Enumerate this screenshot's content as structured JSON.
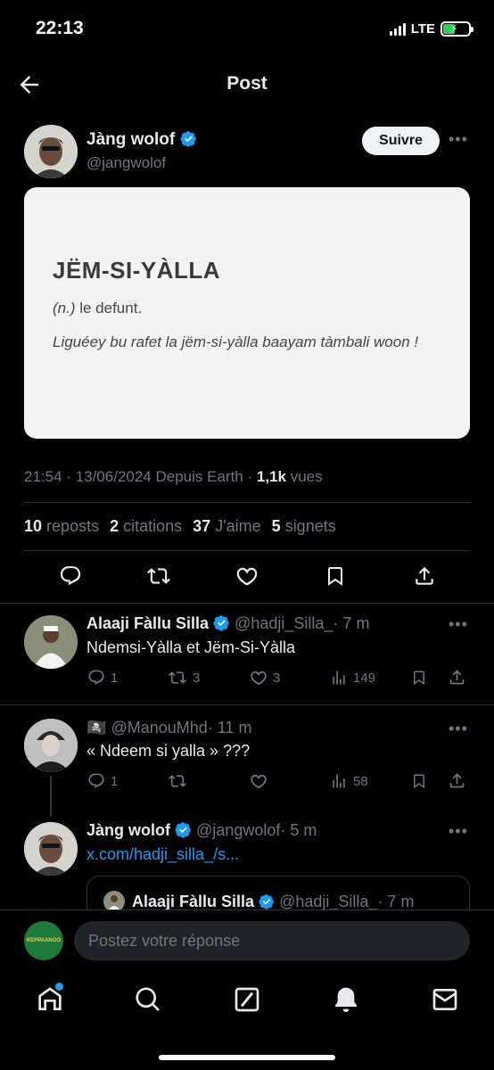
{
  "status_bar": {
    "time": "22:13",
    "network": "LTE"
  },
  "header": {
    "title": "Post"
  },
  "post": {
    "author_name": "Jàng wolof",
    "author_handle": "@jangwolof",
    "follow_label": "Suivre",
    "card": {
      "word": "JËM-SI-YÀLLA",
      "pos": "(n.)",
      "definition": " le defunt.",
      "example": "Liguéey bu rafet la jëm-si-yàlla baayam tàmbali woon !"
    },
    "time": "21:54",
    "date": "13/06/2024",
    "source": "Depuis Earth",
    "views_count": "1,1k",
    "views_label": "vues",
    "stats": {
      "reposts_count": "10",
      "reposts_label": "reposts",
      "quotes_count": "2",
      "quotes_label": "citations",
      "likes_count": "37",
      "likes_label": "J'aime",
      "bookmarks_count": "5",
      "bookmarks_label": "signets"
    }
  },
  "replies": [
    {
      "name": "Alaaji Fàllu Silla",
      "handle": "@hadji_Silla_",
      "age": "· 7 m",
      "text": "Ndemsi-Yàlla et Jëm-Si-Yàlla",
      "replies": "1",
      "reposts": "3",
      "likes": "3",
      "views": "149"
    },
    {
      "name": "🏴‍☠️",
      "handle": "@ManouMhd",
      "age": "· 11 m",
      "text": "« Ndeem si yalla » ???",
      "replies": "1",
      "reposts": "",
      "likes": "",
      "views": "58"
    },
    {
      "name": "Jàng wolof",
      "handle": "@jangwolof",
      "age": "· 5 m",
      "text": "x.com/hadji_silla_/s...",
      "quote": {
        "name": "Alaaji Fàllu Silla",
        "handle": "@hadji_Silla_",
        "age": "· 7 m"
      }
    }
  ],
  "compose": {
    "placeholder": "Postez votre réponse",
    "avatar_text": "KEPPAANGO"
  },
  "colors": {
    "accent": "#1d9bf0",
    "background": "#000000",
    "muted": "#71767b"
  },
  "tabbar": {
    "icons": [
      "home-icon",
      "search-icon",
      "grok-icon",
      "notifications-icon",
      "messages-icon"
    ]
  }
}
